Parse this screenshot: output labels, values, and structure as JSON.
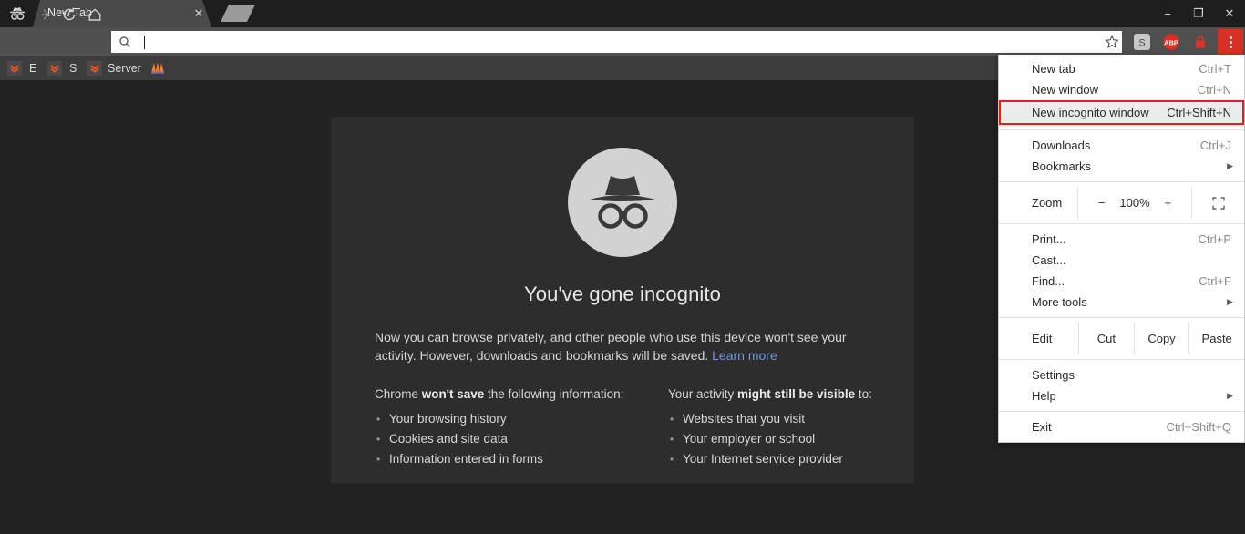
{
  "window": {
    "minimize_label": "−",
    "restore_label": "❐",
    "close_label": "✕"
  },
  "tabstrip": {
    "incognito_icon": "incognito-hat-icon",
    "active_tab_title": "New Tab",
    "close_tab_label": "✕",
    "new_tab_label": ""
  },
  "toolbar": {
    "back_label": "←",
    "forward_label": "→",
    "reload_label": "⟳",
    "home_label": "⌂",
    "omnibox_value": "",
    "omnibox_placeholder": "",
    "star_label": "☆",
    "extensions": [
      {
        "name": "stumbleupon-extension",
        "label": "S"
      },
      {
        "name": "adblock-plus-extension",
        "label": "ABP"
      },
      {
        "name": "lock-extension",
        "label": "lock-icon"
      }
    ],
    "menu_button_name": "three-dot-menu-icon"
  },
  "bookmarks": [
    {
      "name": "bookmark-chevron-1",
      "label": "",
      "icon": "chevron-down-icon"
    },
    {
      "name": "bookmark-e",
      "label": "E",
      "icon": ""
    },
    {
      "name": "bookmark-chevron-2",
      "label": "",
      "icon": "chevron-down-icon"
    },
    {
      "name": "bookmark-s",
      "label": "S",
      "icon": ""
    },
    {
      "name": "bookmark-chevron-3",
      "label": "",
      "icon": "chevron-down-icon"
    },
    {
      "name": "bookmark-server",
      "label": "Server",
      "icon": ""
    },
    {
      "name": "bookmark-xampp",
      "label": "",
      "icon": "xampp-icon"
    }
  ],
  "incognito_page": {
    "icon": "incognito-hat-glasses-icon",
    "headline": "You've gone incognito",
    "paragraph_before_link": "Now you can browse privately, and other people who use this device won't see your activity. However, downloads and bookmarks will be saved. ",
    "learn_more_label": "Learn more",
    "left_column": {
      "heading_prefix": "Chrome ",
      "heading_bold": "won't save",
      "heading_suffix": " the following information:",
      "items": [
        "Your browsing history",
        "Cookies and site data",
        "Information entered in forms"
      ]
    },
    "right_column": {
      "heading_prefix": "Your activity ",
      "heading_bold": "might still be visible",
      "heading_suffix": " to:",
      "items": [
        "Websites that you visit",
        "Your employer or school",
        "Your Internet service provider"
      ]
    }
  },
  "chrome_menu": {
    "items": [
      {
        "label": "New tab",
        "accel": "Ctrl+T"
      },
      {
        "label": "New window",
        "accel": "Ctrl+N"
      },
      {
        "label": "New incognito window",
        "accel": "Ctrl+Shift+N",
        "highlighted": true
      },
      {
        "label": "Downloads",
        "accel": "Ctrl+J"
      },
      {
        "label": "Bookmarks",
        "accel": "",
        "submenu": true
      },
      {
        "label": "Print...",
        "accel": "Ctrl+P"
      },
      {
        "label": "Cast...",
        "accel": ""
      },
      {
        "label": "Find...",
        "accel": "Ctrl+F"
      },
      {
        "label": "More tools",
        "accel": "",
        "submenu": true
      },
      {
        "label": "Settings",
        "accel": ""
      },
      {
        "label": "Help",
        "accel": "",
        "submenu": true
      },
      {
        "label": "Exit",
        "accel": "Ctrl+Shift+Q"
      }
    ],
    "zoom_row": {
      "label": "Zoom",
      "minus_label": "−",
      "level": "100%",
      "plus_label": "+",
      "fullscreen_icon": "fullscreen-icon"
    },
    "edit_row": {
      "label": "Edit",
      "cut_label": "Cut",
      "copy_label": "Copy",
      "paste_label": "Paste"
    },
    "submenu_arrow": "▶"
  },
  "colors": {
    "highlight_border": "#ee1b1b",
    "menu_button_bg": "#d93025",
    "link": "#6b9ae0",
    "page_bg": "#222222",
    "card_bg": "#2d2d2d"
  }
}
